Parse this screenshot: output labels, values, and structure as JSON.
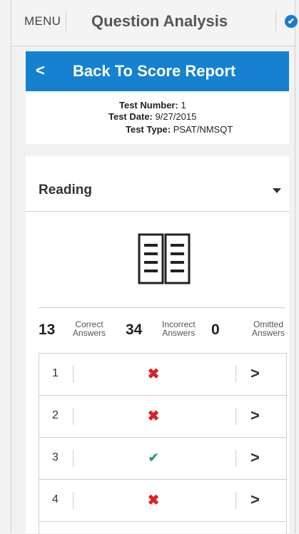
{
  "header": {
    "menu_label": "MENU",
    "title": "Question Analysis",
    "status_icon": "check-circle-icon"
  },
  "back": {
    "label": "Back To Score Report"
  },
  "test_info": {
    "number_label": "Test Number:",
    "number_value": "1",
    "date_label": "Test Date:",
    "date_value": "9/27/2015",
    "type_label": "Test Type:",
    "type_value": "PSAT/NMSQT"
  },
  "section": {
    "selected": "Reading",
    "icon": "open-book-icon"
  },
  "stats": {
    "correct_count": "13",
    "correct_label_1": "Correct",
    "correct_label_2": "Answers",
    "incorrect_count": "34",
    "incorrect_label_1": "Incorrect",
    "incorrect_label_2": "Answers",
    "omitted_count": "0",
    "omitted_label_1": "Omitted",
    "omitted_label_2": "Answers"
  },
  "questions": [
    {
      "number": "1",
      "result": "incorrect",
      "mark": "✖"
    },
    {
      "number": "2",
      "result": "incorrect",
      "mark": "✖"
    },
    {
      "number": "3",
      "result": "correct",
      "mark": "✔"
    },
    {
      "number": "4",
      "result": "incorrect",
      "mark": "✖"
    }
  ],
  "colors": {
    "accent": "#1581cf",
    "incorrect": "#e02020",
    "correct": "#3d9b6f"
  }
}
